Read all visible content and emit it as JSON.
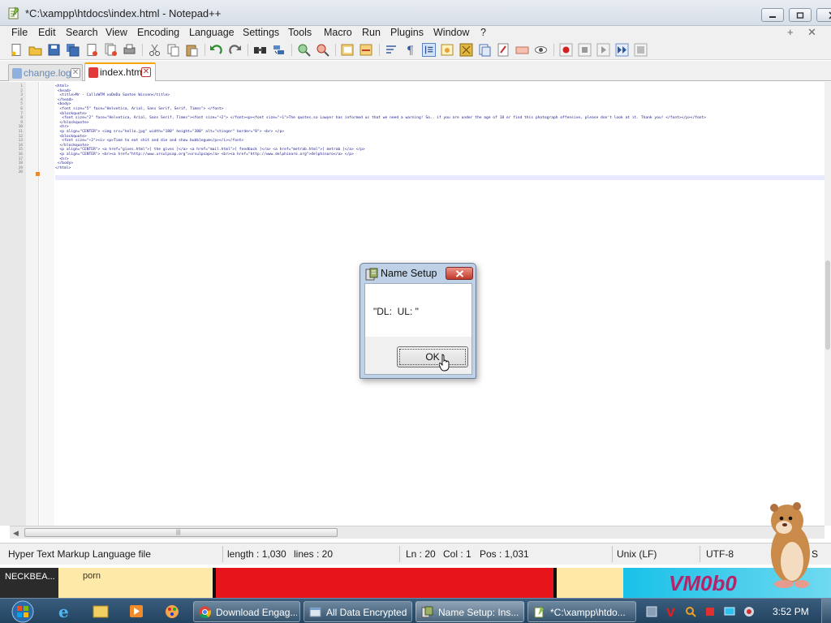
{
  "window": {
    "title": "*C:\\xampp\\htdocs\\index.html - Notepad++"
  },
  "menu": {
    "items": [
      "File",
      "Edit",
      "Search",
      "View",
      "Encoding",
      "Language",
      "Settings",
      "Tools",
      "Macro",
      "Run",
      "Plugins",
      "Window",
      "?"
    ],
    "right_plus": "+",
    "right_close": "✕"
  },
  "toolbar": {
    "icons": [
      "new-file-icon",
      "open-file-icon",
      "save-icon",
      "save-all-icon",
      "close-icon",
      "close-all-icon",
      "print-icon",
      "cut-icon",
      "copy-icon",
      "paste-icon",
      "undo-icon",
      "redo-icon",
      "find-icon",
      "replace-icon",
      "zoom-in-icon",
      "zoom-out-icon",
      "sync-vertical-icon",
      "sync-horizontal-icon",
      "word-wrap-icon",
      "show-all-chars-icon",
      "indent-guide-icon",
      "language-icon",
      "doc-map-icon",
      "function-list-icon",
      "folder-workspace-icon",
      "monitor-icon",
      "record-macro-icon",
      "stop-macro-icon",
      "play-macro-icon",
      "run-macro-multiple-icon",
      "save-macro-icon"
    ]
  },
  "tabs": [
    {
      "label": "change.log",
      "active": false
    },
    {
      "label": "index.html",
      "active": true
    }
  ],
  "editor": {
    "line_numbers": [
      "1",
      "2",
      "3",
      "4",
      "5",
      "6",
      "7",
      "8",
      "9",
      "10",
      "11",
      "12",
      "13",
      "14",
      "15",
      "16",
      "17",
      "18",
      "19",
      "20"
    ],
    "lines": [
      "<html>",
      " <head>",
      "  <title>Mr - CallsWTM voDeDa Santen Wissen</title>",
      " </head>",
      " <body>",
      "  <font size=\"5\" face=\"Helvetica, Arial, Sans Serif, Serif, Times\"> </font>",
      "  <blockquote>",
      "   <font size=\"2\" face=\"Helvetica, Arial, Sans Serif, Times\"><font size=\"+2\"> </font><p><font size=\"+1\">The quotes.so Lawyer has informed us that we need a warning! So.. if you are under the age of 18 or find this photograph offensive, please don't look at it. Thank you! </font></p></font>",
      "  </blockquote>",
      "  <hr>",
      "  <p align=\"CENTER\"> <img src=\"hello.jpg\" width=\"180\" height=\"380\" alt=\"stinger\" border=\"0\"> <br> </p>",
      "  <blockquote>",
      "   <font size=\"+2\"><i> <p>Time to eat shit and die and show bubblegum</p></i></font>",
      "  </blockquote>",
      "  <p align=\"CENTER\"> <a href=\"gives.html\">[ the gives ]</a> <a href=\"mail.html\">[ feedback ]</a> <a href=\"metrab.html\">[ metrab ]</a> </p>",
      "  <p align=\"CENTER\"> <br><a href=\"http://www.ursulpsap.org\">ursulpsap</a> <br><a href=\"http://www.delphinaro.org\">delphinaro</a> </p>",
      "  <hr>",
      " </body>",
      "</html>",
      ""
    ]
  },
  "statusbar": {
    "file_type": "Hyper Text Markup Language file",
    "length": "length : 1,030",
    "lines": "lines : 20",
    "ln": "Ln : 20",
    "col": "Col : 1",
    "pos": "Pos : 1,031",
    "eol": "Unix (LF)",
    "encoding": "UTF-8",
    "mode_suffix": "S"
  },
  "banner": {
    "left_text": "NECKBEA...",
    "mid_text": "porn",
    "right_text": "VM0b0"
  },
  "dialog": {
    "title": "Name Setup",
    "message": "\"DL:  UL: \"",
    "ok_label": "OK"
  },
  "taskbar": {
    "tasks": [
      {
        "label": "Download Engag...",
        "icon": "chrome-icon"
      },
      {
        "label": "All Data Encrypted",
        "icon": "window-icon"
      },
      {
        "label": "Name Setup: Ins...",
        "icon": "installer-icon"
      },
      {
        "label": "*C:\\xampp\\htdo...",
        "icon": "notepad-icon"
      }
    ],
    "clock": "3:52 PM"
  },
  "colors": {
    "accent_tab": "#f7a500",
    "taskbar": "#2c4e6d",
    "banner_red": "#e8141c",
    "banner_blue": "#19c1e8"
  }
}
